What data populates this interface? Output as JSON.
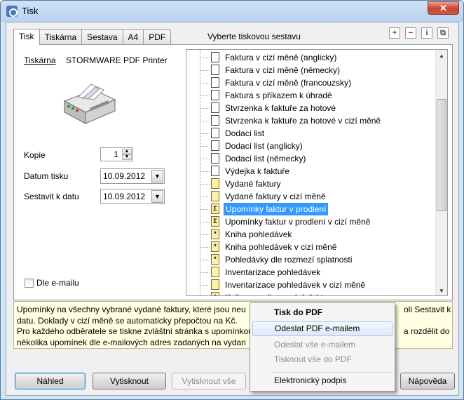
{
  "window": {
    "title": "Tisk",
    "close_label": "✕"
  },
  "tabs": [
    {
      "label": "Tisk"
    },
    {
      "label": "Tiskárna"
    },
    {
      "label": "Sestava"
    },
    {
      "label": "A4"
    },
    {
      "label": "PDF"
    }
  ],
  "tab_heading": "Vyberte tiskovou sestavu",
  "toolbar_icons": [
    "add-icon",
    "remove-icon",
    "info-icon",
    "copy-icon"
  ],
  "printer": {
    "label": "Tiskárna",
    "name": "STORMWARE PDF Printer"
  },
  "fields": {
    "copies_label": "Kopie",
    "copies_value": "1",
    "print_date_label": "Datum tisku",
    "print_date_value": "10.09.2012",
    "compile_date_label": "Sestavit k datu",
    "compile_date_value": "10.09.2012",
    "email_checkbox_label": "Dle e-mailu"
  },
  "reports": [
    {
      "label": "Faktura v cizí měně (anglicky)",
      "icon": "document-icon"
    },
    {
      "label": "Faktura v cizí měně (německy)",
      "icon": "document-icon"
    },
    {
      "label": "Faktura v cizí měně (francouzsky)",
      "icon": "document-icon"
    },
    {
      "label": "Faktura s příkazem k úhradě",
      "icon": "document-icon"
    },
    {
      "label": "Stvrzenka k faktuře za hotové",
      "icon": "document-icon"
    },
    {
      "label": "Stvrzenka k faktuře za hotové v cizí měně",
      "icon": "document-icon"
    },
    {
      "label": "Dodací list",
      "icon": "document-icon"
    },
    {
      "label": "Dodací list (anglicky)",
      "icon": "document-icon"
    },
    {
      "label": "Dodací list (německy)",
      "icon": "document-icon"
    },
    {
      "label": "Výdejka k faktuře",
      "icon": "document-icon"
    },
    {
      "label": "Vydané faktury",
      "icon": "yellow-list-icon"
    },
    {
      "label": "Vydané faktury v cizí měně",
      "icon": "yellow-list-icon"
    },
    {
      "label": "Upomínky faktur v prodlení",
      "icon": "sigma-icon",
      "selected": true
    },
    {
      "label": "Upomínky faktur v prodlení v cizí měně",
      "icon": "sigma-icon"
    },
    {
      "label": "Kniha pohledávek",
      "icon": "star-list-icon"
    },
    {
      "label": "Kniha pohledávek v cizí měně",
      "icon": "star-list-icon"
    },
    {
      "label": "Pohledávky dle rozmezí splatnosti",
      "icon": "star-list-icon"
    },
    {
      "label": "Inventarizace pohledávek",
      "icon": "yellow-list-icon"
    },
    {
      "label": "Inventarizace pohledávek v cizí měně",
      "icon": "yellow-list-icon"
    },
    {
      "label": "Kniha penalizovaných faktur",
      "icon": "star-list-icon"
    }
  ],
  "description": {
    "line1_left": "Upomínky na všechny vybrané vydané faktury, které jsou neu",
    "line1_right": "oli Sestavit k",
    "line2": "datu. Doklady v cizí měně se automaticky přepočtou na Kč.",
    "line3_left": "Pro každého odběratele se tiskne zvláštní stránka s upomínkou",
    "line3_right": "a rozdělit do",
    "line4_left": "několika upomínek dle e-mailových adres zadaných na vydan"
  },
  "buttons": {
    "preview": "Náhled",
    "print": "Vytisknout",
    "print_all": "Vytisknout vše",
    "help": "Nápověda"
  },
  "context_menu": {
    "print_pdf": "Tisk do PDF",
    "send_pdf_email": "Odeslat PDF e-mailem",
    "send_all_email": "Odeslat vše e-mailem",
    "print_all_pdf": "Tisknout vše do PDF",
    "e_signature": "Elektronický podpis"
  }
}
